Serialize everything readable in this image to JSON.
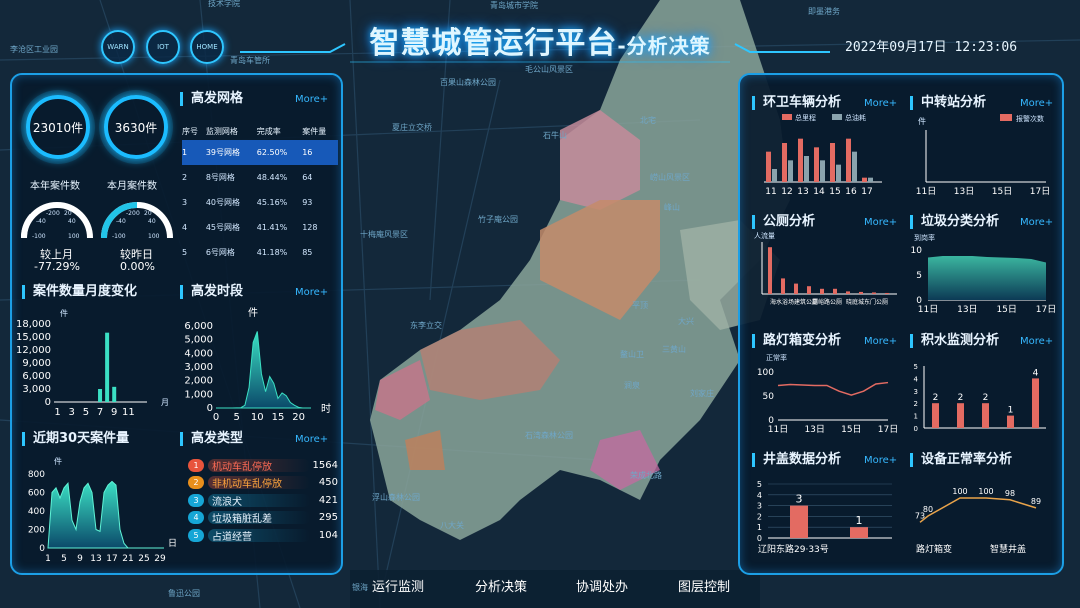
{
  "header": {
    "title_main": "智慧城管运行平台",
    "title_sub": "-分析决策",
    "datetime": "2022年09月17日  12:23:06",
    "hex_buttons": [
      "WARN",
      "IOT",
      "HOME"
    ]
  },
  "map_labels": [
    "技术学院",
    "青岛城市学院",
    "青岛车管所",
    "李沧区工业园",
    "即墨港务",
    "毛公山风景区",
    "百果山森林公园",
    "夏庄立交桥",
    "石牛山",
    "北宅",
    "峰山",
    "竹子庵公园",
    "崂山风景区",
    "十梅庵风景区",
    "东李立交",
    "鳌山卫",
    "三黄山",
    "平顶",
    "大兴",
    "涧泉",
    "刘家庄",
    "石湾森林公园",
    "荣成北路",
    "浮山森林公园",
    "八大关",
    "鲁迅公园",
    "银海"
  ],
  "stats": {
    "year_count": "23010件",
    "month_count": "3630件",
    "year_label": "本年案件数",
    "month_label": "本月案件数",
    "gauge1_compare": "较上月",
    "gauge1_value": "-77.29%",
    "gauge2_compare": "较昨日",
    "gauge2_value": "0.00%",
    "gauge_ticks": [
      "-20",
      "0",
      "20",
      "-40",
      "40",
      "-100",
      "100"
    ]
  },
  "grid_panel": {
    "title": "高发网格",
    "more": "More+",
    "columns": [
      "序号",
      "监测网格",
      "完成率",
      "案件量"
    ],
    "rows": [
      [
        "1",
        "39号网格",
        "62.50%",
        "16"
      ],
      [
        "2",
        "8号网格",
        "48.44%",
        "64"
      ],
      [
        "3",
        "40号网格",
        "45.16%",
        "93"
      ],
      [
        "4",
        "45号网格",
        "41.41%",
        "128"
      ],
      [
        "5",
        "6号网格",
        "41.18%",
        "85"
      ]
    ]
  },
  "monthly": {
    "title": "案件数量月度变化",
    "unit": "件",
    "x_unit": "月"
  },
  "hourly": {
    "title": "高发时段",
    "more": "More+",
    "unit": "件",
    "x_unit": "时"
  },
  "last30": {
    "title": "近期30天案件量",
    "unit": "件",
    "x_unit": "日"
  },
  "types": {
    "title": "高发类型",
    "more": "More+",
    "items": [
      {
        "n": "1",
        "name": "机动车乱停放",
        "count": "1564",
        "color": "#e8543c"
      },
      {
        "n": "2",
        "name": "非机动车乱停放",
        "count": "450",
        "color": "#e88f1c"
      },
      {
        "n": "3",
        "name": "流浪犬",
        "count": "421",
        "color": "#16a6d6"
      },
      {
        "n": "4",
        "name": "垃圾箱脏乱差",
        "count": "295",
        "color": "#16a6d6"
      },
      {
        "n": "5",
        "name": "占道经营",
        "count": "104",
        "color": "#16a6d6"
      }
    ]
  },
  "right": {
    "vehicle": {
      "title": "环卫车辆分析",
      "more": "More+",
      "legend": [
        "总里程",
        "总油耗"
      ]
    },
    "transfer": {
      "title": "中转站分析",
      "more": "More+",
      "unit": "件",
      "legend": "报警次数"
    },
    "toilet": {
      "title": "公厕分析",
      "more": "More+",
      "unit": "人流量",
      "xlabels": [
        "海水浴场建筑公厕",
        "嘉峪路公厕",
        "晓庭城东门公厕"
      ]
    },
    "garbage": {
      "title": "垃圾分类分析",
      "more": "More+",
      "unit": "到岗率"
    },
    "lamp": {
      "title": "路灯箱变分析",
      "more": "More+",
      "unit": "正常率"
    },
    "water": {
      "title": "积水监测分析",
      "more": "More+"
    },
    "manhole": {
      "title": "井盖数据分析",
      "more": "More+",
      "xlabel": "辽阳东路29·33号"
    },
    "device": {
      "title": "设备正常率分析",
      "xlabels": [
        "路灯箱变",
        "智慧井盖"
      ]
    }
  },
  "bottom_nav": [
    "运行监测",
    "分析决策",
    "协调处办",
    "图层控制"
  ],
  "chart_data": [
    {
      "type": "bar",
      "name": "monthly",
      "categories": [
        "1",
        "3",
        "5",
        "7",
        "9",
        "11"
      ],
      "x": [
        1,
        2,
        3,
        4,
        5,
        6,
        7,
        8,
        9,
        10,
        11,
        12
      ],
      "values": [
        0,
        0,
        0,
        0,
        0,
        0,
        3000,
        16000,
        3500,
        0,
        0,
        0
      ],
      "ylim": [
        0,
        18000
      ],
      "yticks": [
        0,
        3000,
        6000,
        9000,
        12000,
        15000,
        18000
      ]
    },
    {
      "type": "area",
      "name": "hourly",
      "xticks": [
        0,
        5,
        10,
        15,
        20
      ],
      "x": [
        0,
        2,
        4,
        6,
        7,
        8,
        9,
        10,
        11,
        12,
        13,
        14,
        15,
        16,
        17,
        18,
        19,
        20,
        21,
        22,
        23
      ],
      "values": [
        0,
        0,
        0,
        20,
        200,
        1500,
        4800,
        5600,
        2500,
        1200,
        2300,
        1800,
        700,
        1100,
        900,
        400,
        200,
        50,
        0,
        0,
        0
      ],
      "ylim": [
        0,
        6000
      ],
      "yticks": [
        0,
        1000,
        2000,
        3000,
        4000,
        5000,
        6000
      ]
    },
    {
      "type": "area",
      "name": "last30",
      "xticks": [
        1,
        5,
        9,
        13,
        17,
        21,
        25,
        29
      ],
      "x": [
        1,
        2,
        3,
        4,
        5,
        6,
        7,
        8,
        9,
        10,
        11,
        12,
        13,
        14,
        15,
        16,
        17,
        18,
        19,
        20,
        21,
        22,
        23,
        24,
        25,
        26,
        27,
        28,
        29,
        30
      ],
      "values": [
        0,
        600,
        650,
        540,
        650,
        700,
        300,
        200,
        500,
        650,
        700,
        600,
        200,
        180,
        600,
        680,
        720,
        680,
        200,
        50,
        0,
        0,
        0,
        0,
        0,
        0,
        0,
        0,
        0,
        0
      ],
      "ylim": [
        0,
        800
      ],
      "yticks": [
        0,
        200,
        400,
        600,
        800
      ]
    },
    {
      "type": "bar",
      "name": "vehicle",
      "categories": [
        "11",
        "12",
        "13",
        "14",
        "15",
        "16",
        "17"
      ],
      "series": [
        {
          "name": "总里程",
          "values": [
            7,
            9,
            10,
            8,
            9,
            10,
            1
          ]
        },
        {
          "name": "总油耗",
          "values": [
            3,
            5,
            6,
            5,
            4,
            7,
            1
          ]
        }
      ]
    },
    {
      "type": "bar",
      "name": "transfer",
      "categories": [
        "11日",
        "13日",
        "15日",
        "17日"
      ],
      "values": [
        0,
        0,
        0,
        0
      ]
    },
    {
      "type": "bar",
      "name": "toilet",
      "values": [
        9,
        3,
        2,
        1.5,
        1,
        1,
        0.5,
        0.4,
        0.3,
        0.2
      ]
    },
    {
      "type": "area",
      "name": "garbage",
      "categories": [
        "11日",
        "13日",
        "15日",
        "17日"
      ],
      "values": [
        8.5,
        8.8,
        8.8,
        8.8,
        8.6,
        8.5,
        8.4,
        8.2,
        7.5
      ],
      "ylim": [
        0,
        10
      ],
      "yticks": [
        0,
        5,
        10
      ]
    },
    {
      "type": "line",
      "name": "lamp",
      "categories": [
        "11日",
        "13日",
        "15日",
        "17日"
      ],
      "values": [
        72,
        74,
        73,
        72,
        72,
        60,
        52,
        60,
        75,
        78
      ],
      "ylim": [
        0,
        100
      ],
      "yticks": [
        0,
        50,
        100
      ]
    },
    {
      "type": "bar",
      "name": "water",
      "values": [
        2,
        2,
        2,
        1,
        4
      ],
      "ylim": [
        0,
        5
      ],
      "yticks": [
        0,
        1,
        2,
        3,
        4,
        5
      ],
      "labels": [
        "2",
        "2",
        "2",
        "1",
        "4"
      ]
    },
    {
      "type": "bar",
      "name": "manhole",
      "values": [
        3,
        1
      ],
      "ylim": [
        0,
        5
      ],
      "yticks": [
        0,
        1,
        2,
        3,
        4,
        5
      ],
      "labels": [
        "3",
        "1"
      ]
    },
    {
      "type": "line",
      "name": "device",
      "values": [
        73,
        80,
        100,
        100,
        98,
        89
      ],
      "labels": [
        "73",
        "80",
        "100",
        "100",
        "98",
        "89"
      ]
    }
  ]
}
